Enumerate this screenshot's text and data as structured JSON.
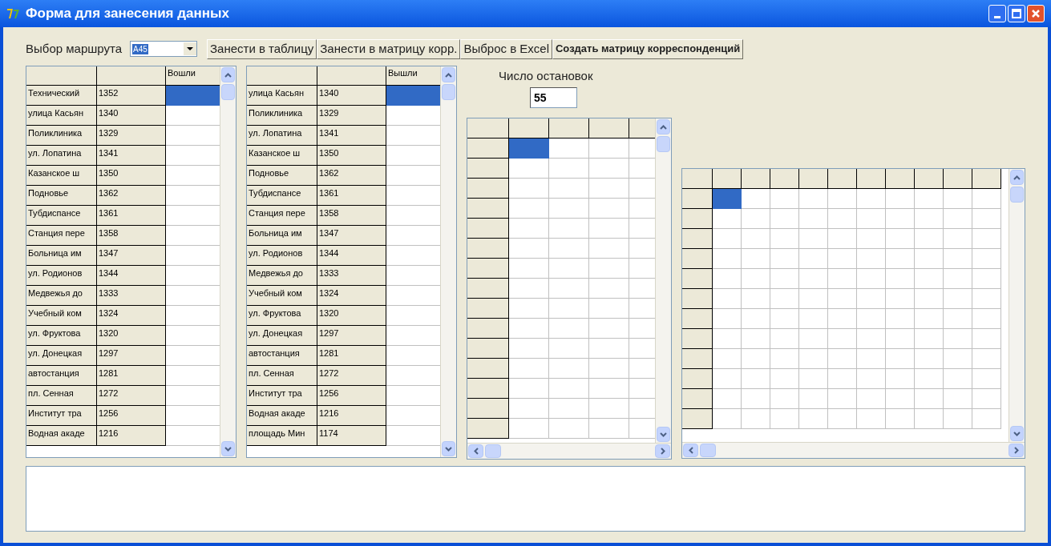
{
  "window": {
    "title": "Форма для занесения данных"
  },
  "route_select": {
    "label": "Выбор маршрута",
    "value": "A45"
  },
  "buttons": [
    {
      "label": "Занести в таблицу",
      "bold": false
    },
    {
      "label": "Занести в матрицу корр.",
      "bold": false
    },
    {
      "label": "Выброс в Excel",
      "bold": false
    },
    {
      "label": "Создать матрицу корреспонденций",
      "bold": true
    }
  ],
  "stops_count": {
    "label": "Число остановок",
    "value": "55"
  },
  "table_in": {
    "column_3": "Вошли",
    "rows": [
      {
        "name": "Технический",
        "code": "1352",
        "selected": true
      },
      {
        "name": "улица Касьян",
        "code": "1340",
        "selected": false
      },
      {
        "name": "Поликлиника",
        "code": "1329",
        "selected": false
      },
      {
        "name": "ул. Лопатина",
        "code": "1341",
        "selected": false
      },
      {
        "name": "Казанское ш",
        "code": "1350",
        "selected": false
      },
      {
        "name": "Подновье",
        "code": "1362",
        "selected": false
      },
      {
        "name": "Тубдиспансе",
        "code": "1361",
        "selected": false
      },
      {
        "name": "Станция пере",
        "code": "1358",
        "selected": false
      },
      {
        "name": "Больница им",
        "code": "1347",
        "selected": false
      },
      {
        "name": "ул. Родионов",
        "code": "1344",
        "selected": false
      },
      {
        "name": "Медвежья до",
        "code": "1333",
        "selected": false
      },
      {
        "name": "Учебный ком",
        "code": "1324",
        "selected": false
      },
      {
        "name": "ул. Фруктова",
        "code": "1320",
        "selected": false
      },
      {
        "name": "ул. Донецкая",
        "code": "1297",
        "selected": false
      },
      {
        "name": "автостанция",
        "code": "1281",
        "selected": false
      },
      {
        "name": "пл. Сенная",
        "code": "1272",
        "selected": false
      },
      {
        "name": "Институт тра",
        "code": "1256",
        "selected": false
      },
      {
        "name": "Водная акаде",
        "code": "1216",
        "selected": false
      }
    ]
  },
  "table_out": {
    "column_3": "Вышли",
    "rows": [
      {
        "name": "улица Касьян",
        "code": "1340",
        "selected": true
      },
      {
        "name": "Поликлиника",
        "code": "1329",
        "selected": false
      },
      {
        "name": "ул. Лопатина",
        "code": "1341",
        "selected": false
      },
      {
        "name": "Казанское ш",
        "code": "1350",
        "selected": false
      },
      {
        "name": "Подновье",
        "code": "1362",
        "selected": false
      },
      {
        "name": "Тубдиспансе",
        "code": "1361",
        "selected": false
      },
      {
        "name": "Станция пере",
        "code": "1358",
        "selected": false
      },
      {
        "name": "Больница им",
        "code": "1347",
        "selected": false
      },
      {
        "name": "ул. Родионов",
        "code": "1344",
        "selected": false
      },
      {
        "name": "Медвежья до",
        "code": "1333",
        "selected": false
      },
      {
        "name": "Учебный ком",
        "code": "1324",
        "selected": false
      },
      {
        "name": "ул. Фруктова",
        "code": "1320",
        "selected": false
      },
      {
        "name": "ул. Донецкая",
        "code": "1297",
        "selected": false
      },
      {
        "name": "автостанция",
        "code": "1281",
        "selected": false
      },
      {
        "name": "пл. Сенная",
        "code": "1272",
        "selected": false
      },
      {
        "name": "Институт тра",
        "code": "1256",
        "selected": false
      },
      {
        "name": "Водная акаде",
        "code": "1216",
        "selected": false
      },
      {
        "name": "площадь Мин",
        "code": "1174",
        "selected": false
      }
    ]
  },
  "matrix_small": {
    "rows": [
      {
        "cells": [
          {
            "selected": true
          },
          {
            "selected": false
          },
          {
            "selected": false
          },
          {
            "selected": false
          }
        ]
      },
      {
        "cells": [
          {
            "selected": false
          },
          {
            "selected": false
          },
          {
            "selected": false
          },
          {
            "selected": false
          }
        ]
      },
      {
        "cells": [
          {
            "selected": false
          },
          {
            "selected": false
          },
          {
            "selected": false
          },
          {
            "selected": false
          }
        ]
      },
      {
        "cells": [
          {
            "selected": false
          },
          {
            "selected": false
          },
          {
            "selected": false
          },
          {
            "selected": false
          }
        ]
      },
      {
        "cells": [
          {
            "selected": false
          },
          {
            "selected": false
          },
          {
            "selected": false
          },
          {
            "selected": false
          }
        ]
      },
      {
        "cells": [
          {
            "selected": false
          },
          {
            "selected": false
          },
          {
            "selected": false
          },
          {
            "selected": false
          }
        ]
      },
      {
        "cells": [
          {
            "selected": false
          },
          {
            "selected": false
          },
          {
            "selected": false
          },
          {
            "selected": false
          }
        ]
      },
      {
        "cells": [
          {
            "selected": false
          },
          {
            "selected": false
          },
          {
            "selected": false
          },
          {
            "selected": false
          }
        ]
      },
      {
        "cells": [
          {
            "selected": false
          },
          {
            "selected": false
          },
          {
            "selected": false
          },
          {
            "selected": false
          }
        ]
      },
      {
        "cells": [
          {
            "selected": false
          },
          {
            "selected": false
          },
          {
            "selected": false
          },
          {
            "selected": false
          }
        ]
      },
      {
        "cells": [
          {
            "selected": false
          },
          {
            "selected": false
          },
          {
            "selected": false
          },
          {
            "selected": false
          }
        ]
      },
      {
        "cells": [
          {
            "selected": false
          },
          {
            "selected": false
          },
          {
            "selected": false
          },
          {
            "selected": false
          }
        ]
      },
      {
        "cells": [
          {
            "selected": false
          },
          {
            "selected": false
          },
          {
            "selected": false
          },
          {
            "selected": false
          }
        ]
      },
      {
        "cells": [
          {
            "selected": false
          },
          {
            "selected": false
          },
          {
            "selected": false
          },
          {
            "selected": false
          }
        ]
      },
      {
        "cells": [
          {
            "selected": false
          },
          {
            "selected": false
          },
          {
            "selected": false
          },
          {
            "selected": false
          }
        ]
      }
    ]
  },
  "matrix_large": {
    "rows": [
      {
        "cells": [
          {
            "selected": true
          },
          {
            "selected": false
          },
          {
            "selected": false
          },
          {
            "selected": false
          },
          {
            "selected": false
          },
          {
            "selected": false
          },
          {
            "selected": false
          },
          {
            "selected": false
          },
          {
            "selected": false
          },
          {
            "selected": false
          }
        ]
      },
      {
        "cells": [
          {
            "selected": false
          },
          {
            "selected": false
          },
          {
            "selected": false
          },
          {
            "selected": false
          },
          {
            "selected": false
          },
          {
            "selected": false
          },
          {
            "selected": false
          },
          {
            "selected": false
          },
          {
            "selected": false
          },
          {
            "selected": false
          }
        ]
      },
      {
        "cells": [
          {
            "selected": false
          },
          {
            "selected": false
          },
          {
            "selected": false
          },
          {
            "selected": false
          },
          {
            "selected": false
          },
          {
            "selected": false
          },
          {
            "selected": false
          },
          {
            "selected": false
          },
          {
            "selected": false
          },
          {
            "selected": false
          }
        ]
      },
      {
        "cells": [
          {
            "selected": false
          },
          {
            "selected": false
          },
          {
            "selected": false
          },
          {
            "selected": false
          },
          {
            "selected": false
          },
          {
            "selected": false
          },
          {
            "selected": false
          },
          {
            "selected": false
          },
          {
            "selected": false
          },
          {
            "selected": false
          }
        ]
      },
      {
        "cells": [
          {
            "selected": false
          },
          {
            "selected": false
          },
          {
            "selected": false
          },
          {
            "selected": false
          },
          {
            "selected": false
          },
          {
            "selected": false
          },
          {
            "selected": false
          },
          {
            "selected": false
          },
          {
            "selected": false
          },
          {
            "selected": false
          }
        ]
      },
      {
        "cells": [
          {
            "selected": false
          },
          {
            "selected": false
          },
          {
            "selected": false
          },
          {
            "selected": false
          },
          {
            "selected": false
          },
          {
            "selected": false
          },
          {
            "selected": false
          },
          {
            "selected": false
          },
          {
            "selected": false
          },
          {
            "selected": false
          }
        ]
      },
      {
        "cells": [
          {
            "selected": false
          },
          {
            "selected": false
          },
          {
            "selected": false
          },
          {
            "selected": false
          },
          {
            "selected": false
          },
          {
            "selected": false
          },
          {
            "selected": false
          },
          {
            "selected": false
          },
          {
            "selected": false
          },
          {
            "selected": false
          }
        ]
      },
      {
        "cells": [
          {
            "selected": false
          },
          {
            "selected": false
          },
          {
            "selected": false
          },
          {
            "selected": false
          },
          {
            "selected": false
          },
          {
            "selected": false
          },
          {
            "selected": false
          },
          {
            "selected": false
          },
          {
            "selected": false
          },
          {
            "selected": false
          }
        ]
      },
      {
        "cells": [
          {
            "selected": false
          },
          {
            "selected": false
          },
          {
            "selected": false
          },
          {
            "selected": false
          },
          {
            "selected": false
          },
          {
            "selected": false
          },
          {
            "selected": false
          },
          {
            "selected": false
          },
          {
            "selected": false
          },
          {
            "selected": false
          }
        ]
      },
      {
        "cells": [
          {
            "selected": false
          },
          {
            "selected": false
          },
          {
            "selected": false
          },
          {
            "selected": false
          },
          {
            "selected": false
          },
          {
            "selected": false
          },
          {
            "selected": false
          },
          {
            "selected": false
          },
          {
            "selected": false
          },
          {
            "selected": false
          }
        ]
      },
      {
        "cells": [
          {
            "selected": false
          },
          {
            "selected": false
          },
          {
            "selected": false
          },
          {
            "selected": false
          },
          {
            "selected": false
          },
          {
            "selected": false
          },
          {
            "selected": false
          },
          {
            "selected": false
          },
          {
            "selected": false
          },
          {
            "selected": false
          }
        ]
      },
      {
        "cells": [
          {
            "selected": false
          },
          {
            "selected": false
          },
          {
            "selected": false
          },
          {
            "selected": false
          },
          {
            "selected": false
          },
          {
            "selected": false
          },
          {
            "selected": false
          },
          {
            "selected": false
          },
          {
            "selected": false
          },
          {
            "selected": false
          }
        ]
      }
    ]
  }
}
